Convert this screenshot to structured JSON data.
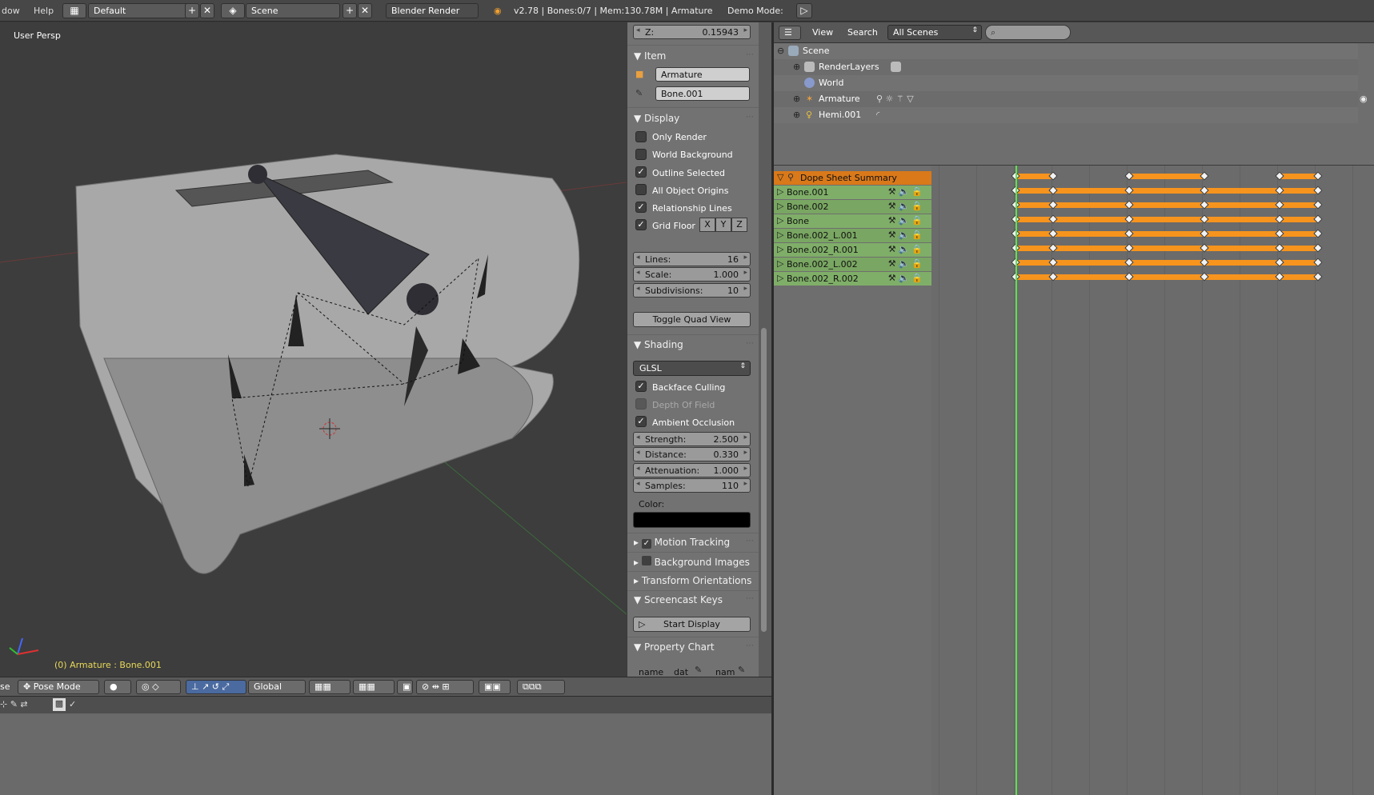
{
  "topbar": {
    "menu_window": "dow",
    "menu_help": "Help",
    "screen_layout": "Default",
    "scene": "Scene",
    "render_engine": "Blender Render",
    "stats": "v2.78 | Bones:0/7 | Mem:130.78M | Armature",
    "demo_mode": "Demo Mode:"
  },
  "viewport": {
    "view_label": "User Persp",
    "status": "(0) Armature : Bone.001"
  },
  "npanel": {
    "z_label": "Z:",
    "z_value": "0.15943",
    "item": {
      "title": "Item",
      "object_name": "Armature",
      "bone_name": "Bone.001"
    },
    "display": {
      "title": "Display",
      "only_render": "Only Render",
      "world_background": "World Background",
      "outline_selected": "Outline Selected",
      "all_object_origins": "All Object Origins",
      "relationship_lines": "Relationship Lines",
      "grid_floor": "Grid Floor",
      "axis_x": "X",
      "axis_y": "Y",
      "axis_z": "Z",
      "lines_label": "Lines:",
      "lines_value": "16",
      "scale_label": "Scale:",
      "scale_value": "1.000",
      "subdiv_label": "Subdivisions:",
      "subdiv_value": "10",
      "toggle_quad": "Toggle Quad View"
    },
    "shading": {
      "title": "Shading",
      "mode": "GLSL",
      "backface_culling": "Backface Culling",
      "depth_of_field": "Depth Of Field",
      "ambient_occlusion": "Ambient Occlusion",
      "strength_label": "Strength:",
      "strength_value": "2.500",
      "distance_label": "Distance:",
      "distance_value": "0.330",
      "attenuation_label": "Attenuation:",
      "attenuation_value": "1.000",
      "samples_label": "Samples:",
      "samples_value": "110",
      "color_label": "Color:"
    },
    "motion_tracking": "Motion Tracking",
    "background_images": "Background Images",
    "transform_orientations": "Transform Orientations",
    "screencast": {
      "title": "Screencast Keys",
      "start": "Start Display"
    },
    "property_chart": {
      "title": "Property Chart",
      "name": "name",
      "dat": "dat",
      "nam": "nam"
    }
  },
  "viewport_header": {
    "left_cut": "se",
    "mode": "Pose Mode",
    "orientation": "Global"
  },
  "outliner": {
    "view": "View",
    "search": "Search",
    "filter": "All Scenes",
    "search_placeholder": "",
    "items": [
      {
        "label": "Scene"
      },
      {
        "label": "RenderLayers"
      },
      {
        "label": "World"
      },
      {
        "label": "Armature"
      },
      {
        "label": "Hemi.001"
      }
    ]
  },
  "dopesheet": {
    "summary": "Dope Sheet Summary",
    "channels": [
      "Bone.001",
      "Bone.002",
      "Bone",
      "Bone.002_L.001",
      "Bone.002_R.001",
      "Bone.002_L.002",
      "Bone.002_R.002"
    ],
    "keyframes": [
      0,
      5,
      15,
      25,
      35,
      40
    ],
    "current_frame": 0
  },
  "colors": {
    "summary_row": "#d9791a",
    "channel_row": "#7fae68",
    "keyframe_bar": "#f7941d",
    "current_frame": "#5ee04f",
    "status_text": "#e7d85a"
  }
}
